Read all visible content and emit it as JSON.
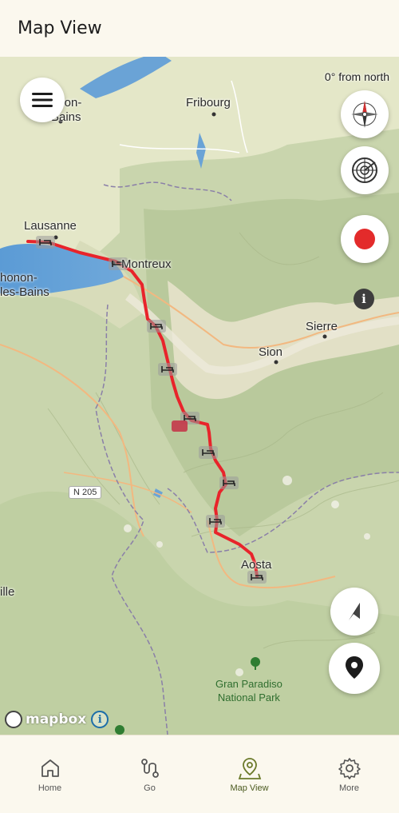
{
  "header": {
    "title": "Map View"
  },
  "map": {
    "heading_text": "0° from north",
    "labels": {
      "fribourg": "Fribourg",
      "lausanne": "Lausanne",
      "montreux": "Montreux",
      "thonon_top": "onon-\nBains",
      "thonon_mid": "honon-\nles-Bains",
      "sierre": "Sierre",
      "sion": "Sion",
      "aosta": "Aosta",
      "road": "N 205",
      "park": "Gran Paradiso\nNational Park",
      "ville": "ille"
    },
    "route_color": "#e8242b",
    "stage_markers": 10,
    "attribution": {
      "logo_text": "mapbox",
      "info": "i"
    }
  },
  "controls": {
    "menu": "menu-icon",
    "compass": "compass-icon",
    "radar": "radar-icon",
    "record": "record-icon",
    "info": "i",
    "navigate": "navigation-arrow-icon",
    "location": "location-pin-icon"
  },
  "nav": {
    "items": [
      {
        "label": "Home",
        "icon": "home-icon"
      },
      {
        "label": "Go",
        "icon": "route-icon"
      },
      {
        "label": "Map View",
        "icon": "map-pin-icon"
      },
      {
        "label": "More",
        "icon": "gear-icon"
      }
    ],
    "active": "Map View"
  }
}
